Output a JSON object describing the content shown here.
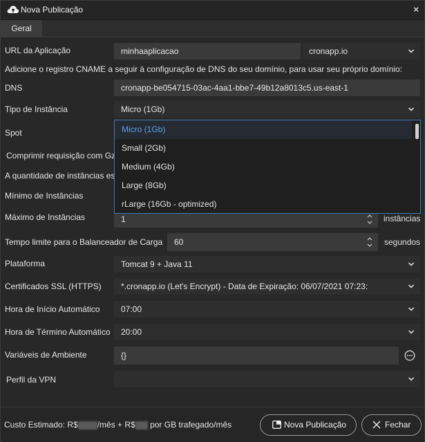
{
  "window": {
    "title": "Nova Publicação",
    "close_glyph": "×"
  },
  "tabs": [
    {
      "label": "Geral"
    }
  ],
  "form": {
    "url_label": "URL da Aplicação",
    "url_value": "minhaaplicacao",
    "domain_value": "cronapp.io",
    "cname_note": "Adicione o registro CNAME a seguir à configuração de DNS do seu domínio, para usar seu próprio domínio:",
    "dns_label": "DNS",
    "dns_value": "cronapp-be054715-03ac-4aa1-bbe7-49b12a8013c5.us-east-1",
    "instance_type_label": "Tipo de Instância",
    "instance_type_value": "Micro (1Gb)",
    "spot_label": "Spot",
    "compress_label": "Comprimir requisição com Gz",
    "instances_note": "A quantidade de instâncias es",
    "min_label": "Mínimo de Instâncias",
    "max_label": "Máximo de Instâncias",
    "max_value": "1",
    "max_unit": "instâncias",
    "timeout_label": "Tempo limite para o Balanceador de Carga",
    "timeout_value": "60",
    "timeout_unit": "segundos",
    "platform_label": "Plataforma",
    "platform_value": "Tomcat 9 + Java 11",
    "ssl_label": "Certificados SSL (HTTPS)",
    "ssl_value": "*.cronapp.io (Let's Encrypt) - Data de Expiração: 06/07/2021 07:23:",
    "start_label": "Hora de Início Automático",
    "start_value": "07:00",
    "end_label": "Hora de Término Automático",
    "end_value": "20:00",
    "env_label": "Variáveis de Ambiente",
    "env_value": "{}",
    "vpn_label": "Perfil da VPN",
    "vpn_value": ""
  },
  "instance_dropdown": {
    "options": [
      "Micro (1Gb)",
      "Small (2Gb)",
      "Medium (4Gb)",
      "Large (8Gb)",
      "rLarge (16Gb - optimized)"
    ],
    "selected_index": 0
  },
  "footer": {
    "cost_prefix": "Custo Estimado:  R$",
    "cost_mid": "/mês + R$",
    "cost_suffix": " por GB trafegado/mês",
    "publish_label": "Nova Publicação",
    "close_label": "Fechar"
  },
  "colors": {
    "accent": "#5aa0e8",
    "dropdown_border": "#3d7bbf",
    "field_bg": "#3a3a3a"
  },
  "icons": [
    "cloud-upload-icon",
    "close-icon",
    "chevron-down-icon",
    "spinner-arrows-icon",
    "more-options-icon",
    "publish-icon",
    "close-circle-icon"
  ]
}
